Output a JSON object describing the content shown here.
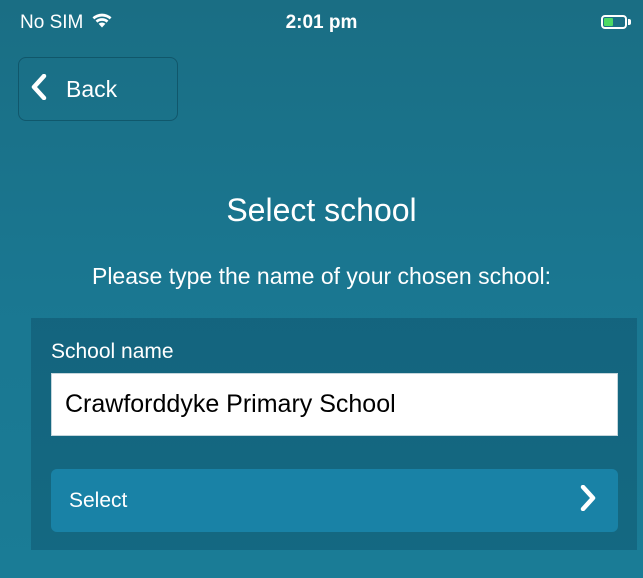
{
  "status_bar": {
    "carrier": "No SIM",
    "time": "2:01 pm",
    "battery_level": 0.45,
    "battery_color": "#4cd964"
  },
  "nav": {
    "back_label": "Back",
    "back_icon": "chevron-left-icon"
  },
  "page": {
    "title": "Select school",
    "instruction": "Please type the name of your chosen school:"
  },
  "form": {
    "field_label": "School name",
    "school_name_value": "Crawforddyke Primary School",
    "select_label": "Select",
    "select_icon": "chevron-right-icon"
  },
  "colors": {
    "background": "#1a7791",
    "panel": "#155d75",
    "button": "#1982a6"
  }
}
